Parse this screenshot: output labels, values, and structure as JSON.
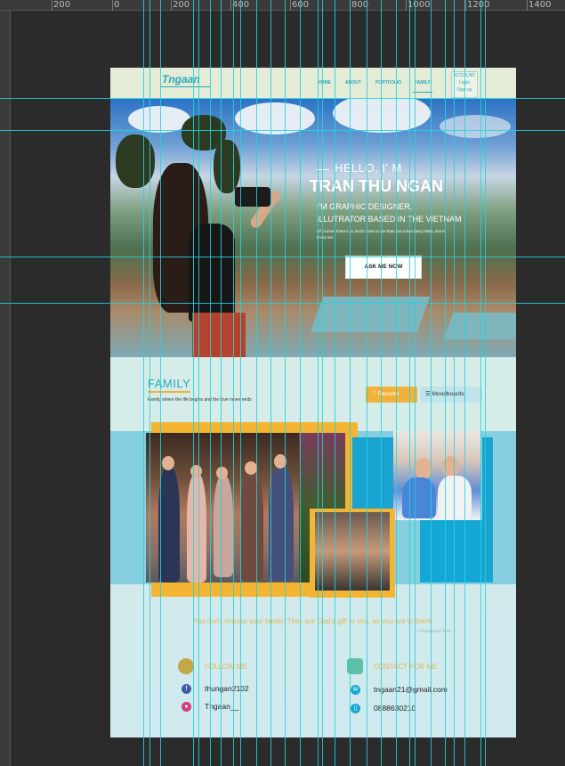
{
  "ruler": {
    "labels": [
      "200",
      "0",
      "200",
      "400",
      "600",
      "800",
      "1000",
      "1200",
      "1400"
    ]
  },
  "nav": {
    "logo": "Tngaan",
    "links": [
      "HOME",
      "ABOUT",
      "PORTFOLIO",
      "FAMILY"
    ],
    "account_title": "ACCOUNT",
    "login": "Login",
    "signup": "Sign up"
  },
  "hero": {
    "hello": "HELLO, I' M",
    "name": "TRAN THU NGAN",
    "subtitle_line1": "I'M GRAPHIC DESIGNER,",
    "subtitle_line2": "ILLUTRATOR BASED IN THE VIETNAM",
    "description": "Of course, there's so much more to me than just a few fancy titles. Get to know me.",
    "button": "ASK ME NOW"
  },
  "family": {
    "title": "FAMILY",
    "tagline": "Family where the life begins and the love never ends",
    "favorite_button": "Favorite",
    "moodboards_button": "Moodboards",
    "quote": "You don't choose your family. They are God's gift to you, as you are to them.",
    "quote_author": "– Desmond Tutu –"
  },
  "footer": {
    "follow_title": "FOLLOW ME",
    "contact_title": "CONTACT FOR ME",
    "facebook": "thungan2102",
    "instagram": "Tngaan__",
    "email": "tngaan21@gmail.com",
    "phone": "0888630210"
  },
  "colors": {
    "accent": "#2aa9b8",
    "gold": "#f2b23a",
    "guide": "#22d3dd"
  }
}
